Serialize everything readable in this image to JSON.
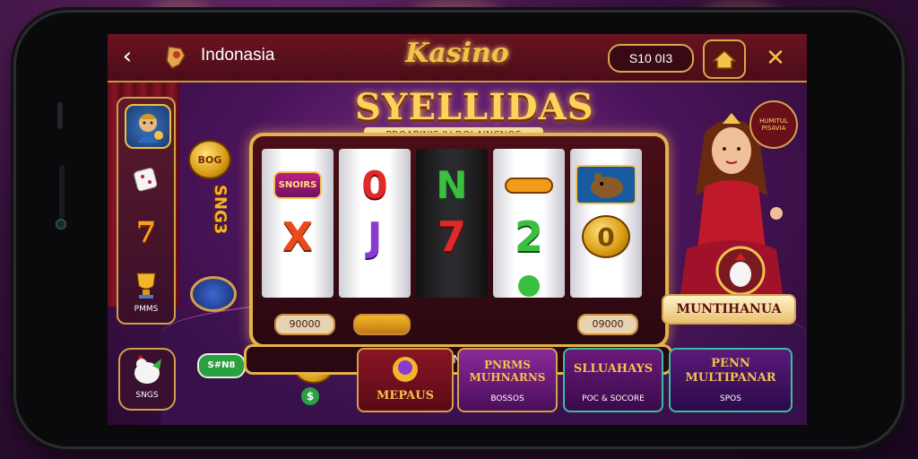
{
  "topbar": {
    "back_glyph": "‹",
    "country": "Indonasia",
    "logo": "Kasino",
    "balance": "S10 0I3",
    "close_glyph": "✕"
  },
  "sidebar": {
    "items": [
      {
        "icon": "character-icon",
        "label": ""
      },
      {
        "icon": "dice-icon",
        "label": ""
      },
      {
        "icon": "seven-icon",
        "label": "7"
      },
      {
        "icon": "trophy-icon",
        "label": "PMMS"
      }
    ],
    "bottom_label": "SNGS"
  },
  "game": {
    "title": "SYELLIDAS",
    "subtitle": "PROABINIS IV DOLAINCNOS",
    "reels": [
      {
        "symbols": [
          "SNOIRS",
          "X",
          ""
        ]
      },
      {
        "symbols": [
          "0",
          "J",
          ""
        ]
      },
      {
        "symbols": [
          "N",
          "7",
          ""
        ]
      },
      {
        "symbols": [
          "",
          "2",
          ""
        ]
      },
      {
        "symbols": [
          "",
          "0",
          ""
        ]
      }
    ],
    "field_left": "90000",
    "field_right": "09000",
    "footer": "I6S0S DN PISINES",
    "side_coin_label": "BOG",
    "side_text": "SNG3"
  },
  "promo": {
    "badge": "HUMITUL PISAVIA",
    "multi_label": "MUNTIHANUA"
  },
  "bottom_cards": [
    {
      "title": "MEPAUS",
      "sub": ""
    },
    {
      "title": "PNRMS MUHNARNS",
      "sub": "BOSSOS"
    },
    {
      "title": "SLLUAHAYS",
      "sub": "POC & SOCORE"
    },
    {
      "title": "PENN MULTIPANAR",
      "sub": "SPOS"
    }
  ],
  "chips": {
    "left_chip": "S#N8",
    "coin_btn": "$"
  },
  "colors": {
    "gold": "#e3b24a",
    "maroon": "#5a1418",
    "purple": "#4a145a"
  }
}
